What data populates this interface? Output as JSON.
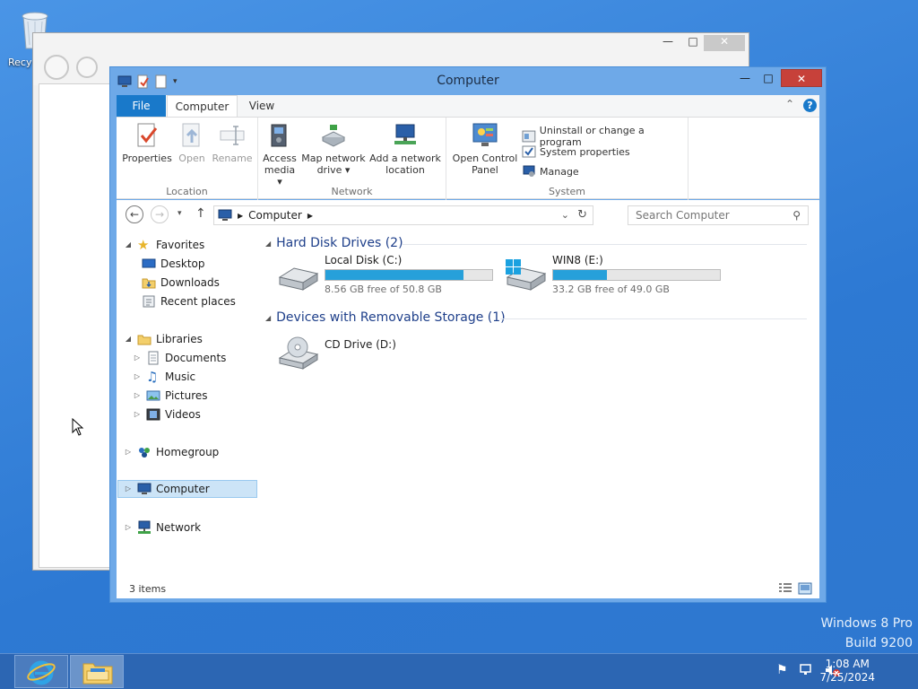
{
  "desktop": {
    "recycle_label": "Recy",
    "watermark": {
      "edition": "Windows 8 Pro",
      "build": "Build 9200"
    }
  },
  "explorer": {
    "title": "Computer",
    "tabs": [
      {
        "label": "File"
      },
      {
        "label": "Computer"
      },
      {
        "label": "View"
      }
    ],
    "ribbon": {
      "location": {
        "label": "Location",
        "buttons": [
          {
            "label": "Properties"
          },
          {
            "label": "Open"
          },
          {
            "label": "Rename"
          }
        ]
      },
      "network": {
        "label": "Network",
        "buttons": [
          {
            "label": "Access media ▾"
          },
          {
            "label": "Map network drive ▾"
          },
          {
            "label": "Add a network location"
          }
        ]
      },
      "system": {
        "label": "System",
        "open_control_panel": "Open Control Panel",
        "items": [
          {
            "label": "Uninstall or change a program"
          },
          {
            "label": "System properties"
          },
          {
            "label": "Manage"
          }
        ]
      }
    },
    "address": {
      "path": "Computer"
    },
    "search": {
      "placeholder": "Search Computer"
    },
    "nav": {
      "favorites": "Favorites",
      "favorites_items": [
        "Desktop",
        "Downloads",
        "Recent places"
      ],
      "libraries": "Libraries",
      "libraries_items": [
        "Documents",
        "Music",
        "Pictures",
        "Videos"
      ],
      "homegroup": "Homegroup",
      "computer": "Computer",
      "network": "Network"
    },
    "groups": {
      "hdd": "Hard Disk Drives (2)",
      "removable": "Devices with Removable Storage (1)"
    },
    "drives": [
      {
        "name": "Local Disk (C:)",
        "free": "8.56 GB free of 50.8 GB",
        "used_fraction": 0.83
      },
      {
        "name": "WIN8 (E:)",
        "free": "33.2 GB free of 49.0 GB",
        "used_fraction": 0.32
      }
    ],
    "cd_drive": {
      "name": "CD Drive (D:)"
    },
    "status": "3 items"
  },
  "taskbar": {
    "time": "1:08 AM",
    "date": "7/25/2024"
  },
  "colors": {
    "accent": "#1979ca",
    "drive_fill": "#26a0da",
    "close": "#c7413a"
  }
}
